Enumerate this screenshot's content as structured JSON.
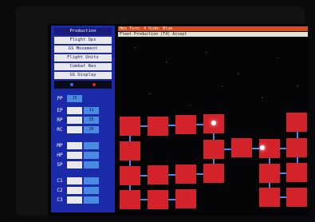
{
  "menu": {
    "items": [
      {
        "label": "Production",
        "active": true
      },
      {
        "label": "Flight Ops",
        "active": false
      },
      {
        "label": "GS Movement",
        "active": false
      },
      {
        "label": "Flight Units",
        "active": false
      },
      {
        "label": "Combat Res",
        "active": false
      },
      {
        "label": "GS Display",
        "active": false
      }
    ]
  },
  "status": {
    "dot_left_color": "#3a6ee8",
    "dot_right_color": "#e02020"
  },
  "stats": [
    {
      "label": "PP",
      "a": "",
      "b": "15"
    },
    {
      "label": "EP",
      "a": "",
      "b": "11"
    },
    {
      "label": "RP",
      "a": "",
      "b": "35"
    },
    {
      "label": "RC",
      "a": "",
      "b": "26"
    },
    {
      "label": "MP",
      "a": "",
      "b": ""
    },
    {
      "label": "HP",
      "a": "",
      "b": ""
    },
    {
      "label": "SP",
      "a": "",
      "b": ""
    },
    {
      "label": "C1",
      "a": "",
      "b": ""
    },
    {
      "label": "C2",
      "a": "",
      "b": ""
    },
    {
      "label": "C3",
      "a": "",
      "b": ""
    }
  ],
  "topbar": {
    "text": "Hex Turn: 4  Side: Blue"
  },
  "subbar": {
    "text": "Fleet Production   (T4) Accept"
  },
  "colors": {
    "block": "#d4222a",
    "panel": "#1b2aa8",
    "connector": "#4a8ae0",
    "topbar": "#d84a1c"
  }
}
